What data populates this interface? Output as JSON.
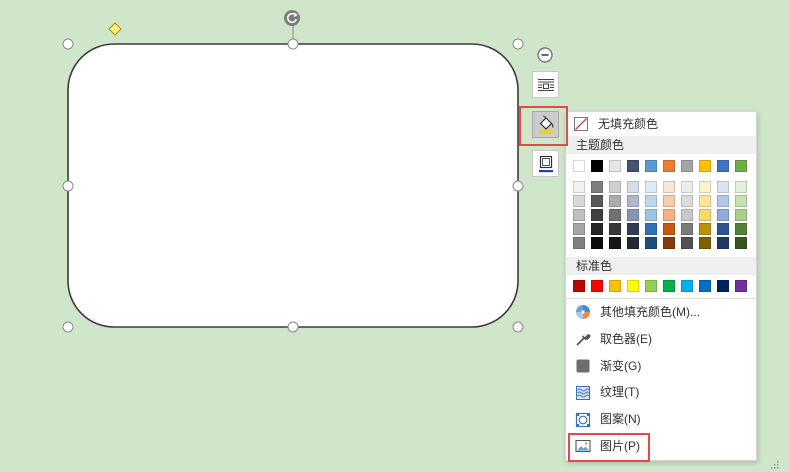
{
  "canvas": {
    "background": "#cfe6ca"
  },
  "colors": {
    "shape_fill": "#ffffff",
    "shape_stroke": "#3c3c3c",
    "handle_stroke": "#8a8a8a",
    "adjust_handle": "#fff386",
    "highlight": "#e5484a",
    "fill_bucket_bar": "#f2d200",
    "outline_bar": "#1a3fbf"
  },
  "shape_toolbar": {
    "collapse_icon": "minus-circle-icon",
    "buttons": [
      {
        "icon": "text-wrap-icon",
        "pressed": false
      },
      {
        "icon": "paint-bucket-icon",
        "pressed": true
      },
      {
        "icon": "shape-outline-icon",
        "pressed": false
      }
    ]
  },
  "fill_menu": {
    "no_fill": {
      "label": "无填充颜色",
      "icon": "no-fill-icon"
    },
    "theme_section": {
      "label": "主题颜色",
      "base_colors": [
        "#FFFFFF",
        "#000000",
        "#E7E6E6",
        "#44546A",
        "#5B9BD5",
        "#ED7D31",
        "#A5A5A5",
        "#FFC000",
        "#4472C4",
        "#70AD47"
      ],
      "shades": [
        [
          "#F2F2F2",
          "#7F7F7F",
          "#D0CECE",
          "#D6DCE4",
          "#DEEBF6",
          "#FBE5D5",
          "#EDEDED",
          "#FFF2CC",
          "#DAE3F3",
          "#E2EFD9"
        ],
        [
          "#D9D9D9",
          "#595959",
          "#AEABAB",
          "#ADB9CA",
          "#BDD7EE",
          "#F7CBAC",
          "#DBDBDB",
          "#FEE599",
          "#B4C7E7",
          "#C5E0B3"
        ],
        [
          "#BFBFBF",
          "#404040",
          "#757070",
          "#8497B0",
          "#9DC3E6",
          "#F4B183",
          "#C9C9C9",
          "#FFD965",
          "#8FAADC",
          "#A8D08D"
        ],
        [
          "#A6A6A6",
          "#262626",
          "#3A3838",
          "#333F4F",
          "#2E75B5",
          "#C55A11",
          "#7B7B7B",
          "#BF9000",
          "#2F5597",
          "#538135"
        ],
        [
          "#808080",
          "#0D0D0D",
          "#171616",
          "#222A35",
          "#1F4E79",
          "#843C0B",
          "#525252",
          "#7F6000",
          "#203864",
          "#375623"
        ]
      ]
    },
    "standard_section": {
      "label": "标准色",
      "colors": [
        "#C00000",
        "#FF0000",
        "#FFC000",
        "#FFFF00",
        "#92D050",
        "#00B050",
        "#00B0F0",
        "#0070C0",
        "#002060",
        "#7030A0"
      ]
    },
    "items": [
      {
        "label": "其他填充颜色(M)...",
        "icon": "color-wheel-icon"
      },
      {
        "label": "取色器(E)",
        "icon": "eyedropper-icon"
      },
      {
        "label": "渐变(G)",
        "icon": "gradient-icon"
      },
      {
        "label": "纹理(T)",
        "icon": "texture-icon"
      },
      {
        "label": "图案(N)",
        "icon": "pattern-icon"
      },
      {
        "label": "图片(P)",
        "icon": "picture-icon",
        "highlighted": true
      }
    ]
  }
}
